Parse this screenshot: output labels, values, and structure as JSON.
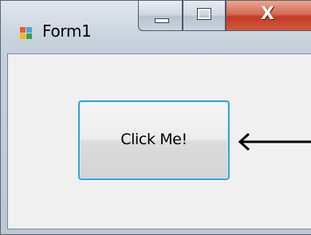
{
  "window": {
    "title": "Form1",
    "app_icon": "winforms-app-icon",
    "caption_buttons": {
      "minimize_icon": "minimize-icon",
      "maximize_icon": "maximize-icon",
      "close_icon": "close-icon",
      "close_glyph": "X"
    }
  },
  "form": {
    "button_label": "Click Me!",
    "button_focus_color": "#3c9fd6"
  },
  "annotation": {
    "icon": "left-arrow-icon",
    "color": "#000000"
  }
}
